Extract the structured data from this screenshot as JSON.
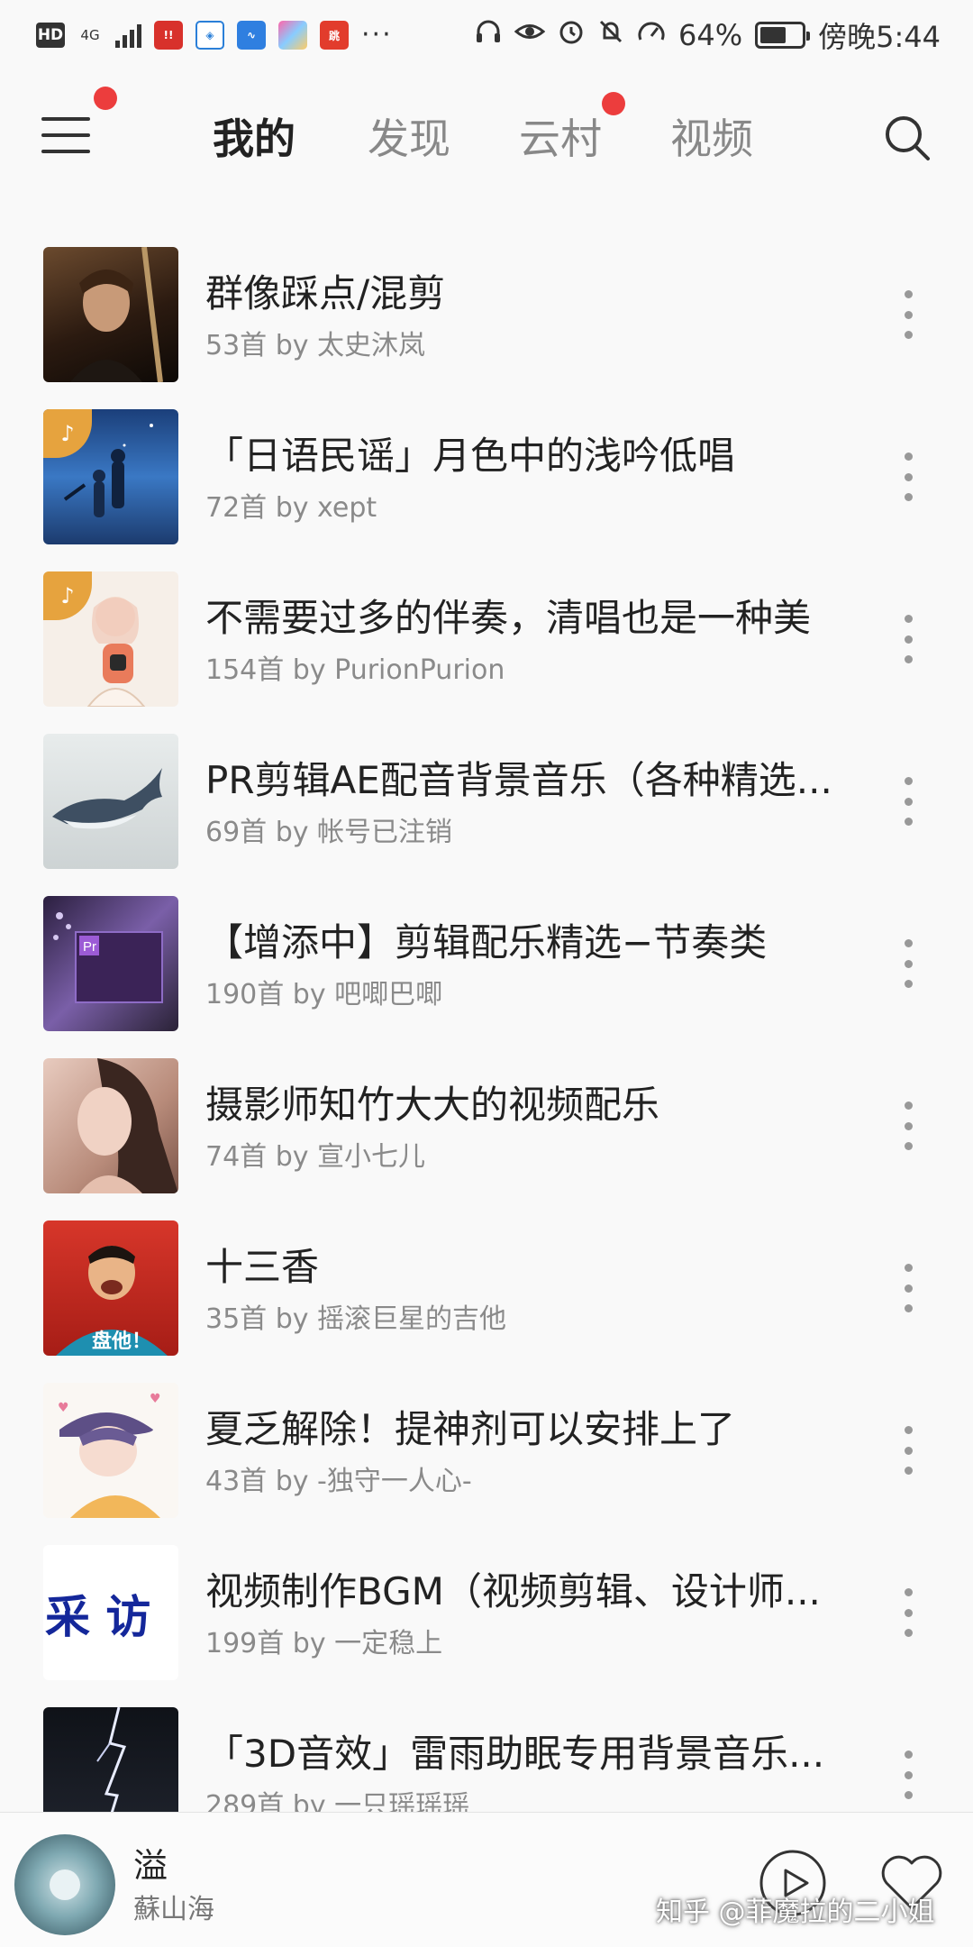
{
  "status_bar": {
    "hd": "HD",
    "network": "4G",
    "battery_level": 64,
    "battery_text": "64%",
    "time": "傍晚5:44",
    "app_icons": [
      "news-app-icon",
      "shield-app-icon",
      "wave-app-icon",
      "gallery-app-icon",
      "game-app-icon"
    ]
  },
  "nav": {
    "tabs": [
      {
        "label": "我的",
        "active": true
      },
      {
        "label": "发现",
        "active": false
      },
      {
        "label": "云村",
        "active": false
      },
      {
        "label": "视频",
        "active": false
      }
    ],
    "accent_color": "#ec3d3d"
  },
  "playlists": [
    {
      "title": "群像踩点/混剪",
      "subtitle": "53首 by 太史沐岚",
      "cover_color": "#3a2a1c",
      "tagged": false
    },
    {
      "title": "「日语民谣」月色中的浅吟低唱",
      "subtitle": "72首 by xept",
      "cover_color": "#2a5a9a",
      "tagged": true
    },
    {
      "title": "不需要过多的伴奏，清唱也是一种美",
      "subtitle": "154首 by PurionPurion",
      "cover_color": "#f2e6dc",
      "tagged": true
    },
    {
      "title": "PR剪辑AE配音背景音乐（各种精选...",
      "subtitle": "69首 by 帐号已注销",
      "cover_color": "#d6dcdd",
      "tagged": false
    },
    {
      "title": "【增添中】剪辑配乐精选−节奏类",
      "subtitle": "190首 by 吧唧巴唧",
      "cover_color": "#4a3a6a",
      "tagged": false
    },
    {
      "title": "摄影师知竹大大的视频配乐",
      "subtitle": "74首 by 宣小七儿",
      "cover_color": "#c89a86",
      "tagged": false
    },
    {
      "title": "十三香",
      "subtitle": "35首 by 摇滚巨星的吉他",
      "cover_color": "#c8281e",
      "tagged": false
    },
    {
      "title": "夏乏解除！提神剂可以安排上了",
      "subtitle": "43首 by -独守一人心-",
      "cover_color": "#f7f3ee",
      "tagged": false
    },
    {
      "title": "视频制作BGM（视频剪辑、设计师...",
      "subtitle": "199首 by 一定稳上",
      "cover_color": "#ffffff",
      "tagged": false
    },
    {
      "title": "「3D音效」雷雨助眠专用背景音乐...",
      "subtitle": "289首 by 一只瑶瑶瑶",
      "cover_color": "#15181f",
      "tagged": false
    }
  ],
  "cover_text_caifang": "采 访",
  "cover_text_pan": "盘他！",
  "player": {
    "title": "溢",
    "artist": "蘇山海"
  },
  "watermark": "知乎 @菲魔拉的二小姐"
}
